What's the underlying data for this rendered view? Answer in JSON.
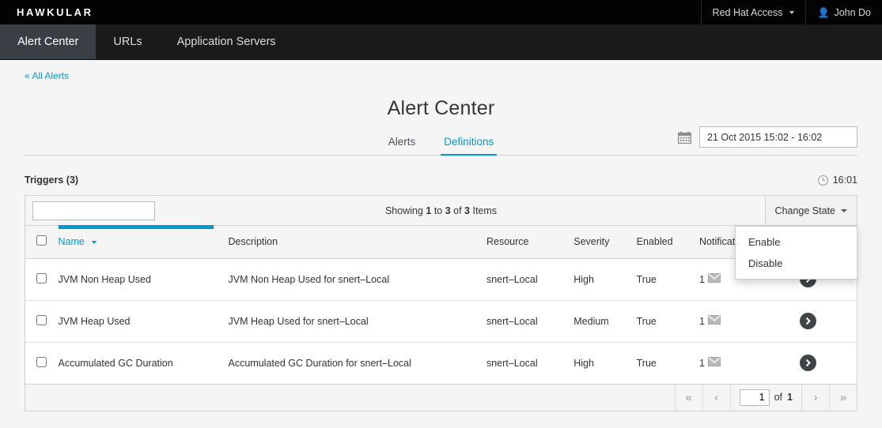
{
  "topbar": {
    "brand": "HAWKULAR",
    "items": [
      {
        "label": "Red Hat Access",
        "icon": "chevron-down-icon",
        "has_caret": true
      },
      {
        "label": "John Do",
        "icon": "user-icon",
        "has_caret": false
      }
    ]
  },
  "nav": {
    "tabs": [
      {
        "label": "Alert Center",
        "active": true
      },
      {
        "label": "URLs",
        "active": false
      },
      {
        "label": "Application Servers",
        "active": false
      }
    ]
  },
  "page": {
    "breadcrumb": "« All Alerts",
    "title": "Alert Center",
    "date_range": "21 Oct 2015 15:02 - 16:02",
    "date_icon": "calendar-icon",
    "subtabs": [
      {
        "label": "Alerts",
        "active": false
      },
      {
        "label": "Definitions",
        "active": true
      }
    ]
  },
  "triggers": {
    "heading": "Triggers (3)",
    "clock_icon": "clock-icon",
    "clock_time": "16:01"
  },
  "toolbar": {
    "search_value": "",
    "search_placeholder": "",
    "showing_prefix": "Showing ",
    "showing_from": "1",
    "showing_mid": " to ",
    "showing_to": "3",
    "showing_of": " of ",
    "showing_total": "3",
    "showing_suffix": " Items",
    "change_state_label": "Change State",
    "dropdown_open": true,
    "dropdown_items": [
      {
        "label": "Enable"
      },
      {
        "label": "Disable"
      }
    ]
  },
  "table": {
    "columns": [
      {
        "key": "name",
        "label": "Name",
        "sorted": true,
        "sort_dir": "desc"
      },
      {
        "key": "description",
        "label": "Description",
        "sorted": false
      },
      {
        "key": "resource",
        "label": "Resource",
        "sorted": false
      },
      {
        "key": "severity",
        "label": "Severity",
        "sorted": false
      },
      {
        "key": "enabled",
        "label": "Enabled",
        "sorted": false
      },
      {
        "key": "notifications",
        "label": "Notifications",
        "sorted": false
      }
    ],
    "rows": [
      {
        "name": "JVM Non Heap Used",
        "description": "JVM Non Heap Used for snert–Local",
        "resource": "snert–Local",
        "severity": "High",
        "enabled": "True",
        "notifications": "1",
        "notif_icon": "envelope-icon",
        "action_icon": "chevron-right-circle-icon"
      },
      {
        "name": "JVM Heap Used",
        "description": "JVM Heap Used for snert–Local",
        "resource": "snert–Local",
        "severity": "Medium",
        "enabled": "True",
        "notifications": "1",
        "notif_icon": "envelope-icon",
        "action_icon": "chevron-right-circle-icon"
      },
      {
        "name": "Accumulated GC Duration",
        "description": "Accumulated GC Duration for snert–Local",
        "resource": "snert–Local",
        "severity": "High",
        "enabled": "True",
        "notifications": "1",
        "notif_icon": "envelope-icon",
        "action_icon": "chevron-right-circle-icon"
      }
    ]
  },
  "pagination": {
    "first_label": "«",
    "prev_label": "‹",
    "page_value": "1",
    "of_label": "of",
    "total_pages": "1",
    "next_label": "›",
    "last_label": "»"
  },
  "colors": {
    "accent": "#0099d3",
    "navbar": "#1a1a1a",
    "navbar_active": "#393f44",
    "topbar": "#030303",
    "page_bg": "#f5f5f5"
  }
}
